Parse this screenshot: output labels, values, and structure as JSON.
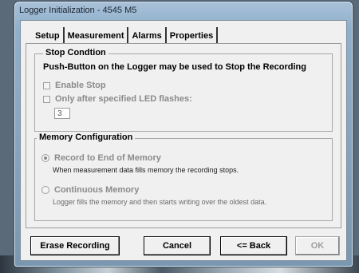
{
  "window": {
    "title": "Logger Initialization - 4545 M5"
  },
  "tabs": [
    {
      "label": "Setup"
    },
    {
      "label": "Measurement"
    },
    {
      "label": "Alarms"
    },
    {
      "label": "Properties"
    }
  ],
  "stop_condition": {
    "legend": "Stop Condtion",
    "info": "Push-Button on the Logger may be used to Stop the Recording",
    "enable_stop": {
      "label": "Enable Stop",
      "checked": false
    },
    "led_flashes": {
      "label": "Only after specified LED flashes:",
      "checked": false,
      "value": "3"
    }
  },
  "memory": {
    "legend": "Memory Configuration",
    "record_to_end": {
      "label": "Record to End of Memory",
      "selected": true,
      "description": "When measurement data fills memory the recording stops."
    },
    "continuous": {
      "label": "Continuous Memory",
      "selected": false,
      "description": "Logger fills the memory and then starts writing over the oldest data."
    }
  },
  "buttons": {
    "erase": "Erase Recording",
    "cancel": "Cancel",
    "back": "<= Back",
    "ok": "OK"
  }
}
